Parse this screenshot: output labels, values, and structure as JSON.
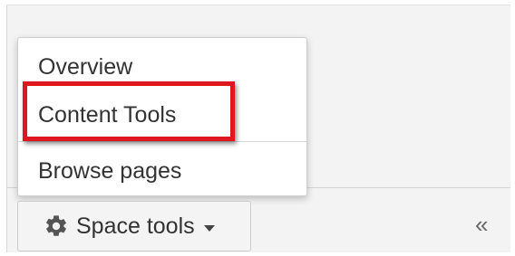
{
  "menu": {
    "items": [
      {
        "label": "Overview"
      },
      {
        "label": "Content Tools"
      },
      {
        "label": "Browse pages"
      }
    ]
  },
  "space_tools": {
    "label": "Space tools",
    "icon": "gear-icon"
  },
  "collapse": {
    "label": "«"
  },
  "colors": {
    "highlight": "#e0161e",
    "panel_bg": "#f3f3f3"
  }
}
